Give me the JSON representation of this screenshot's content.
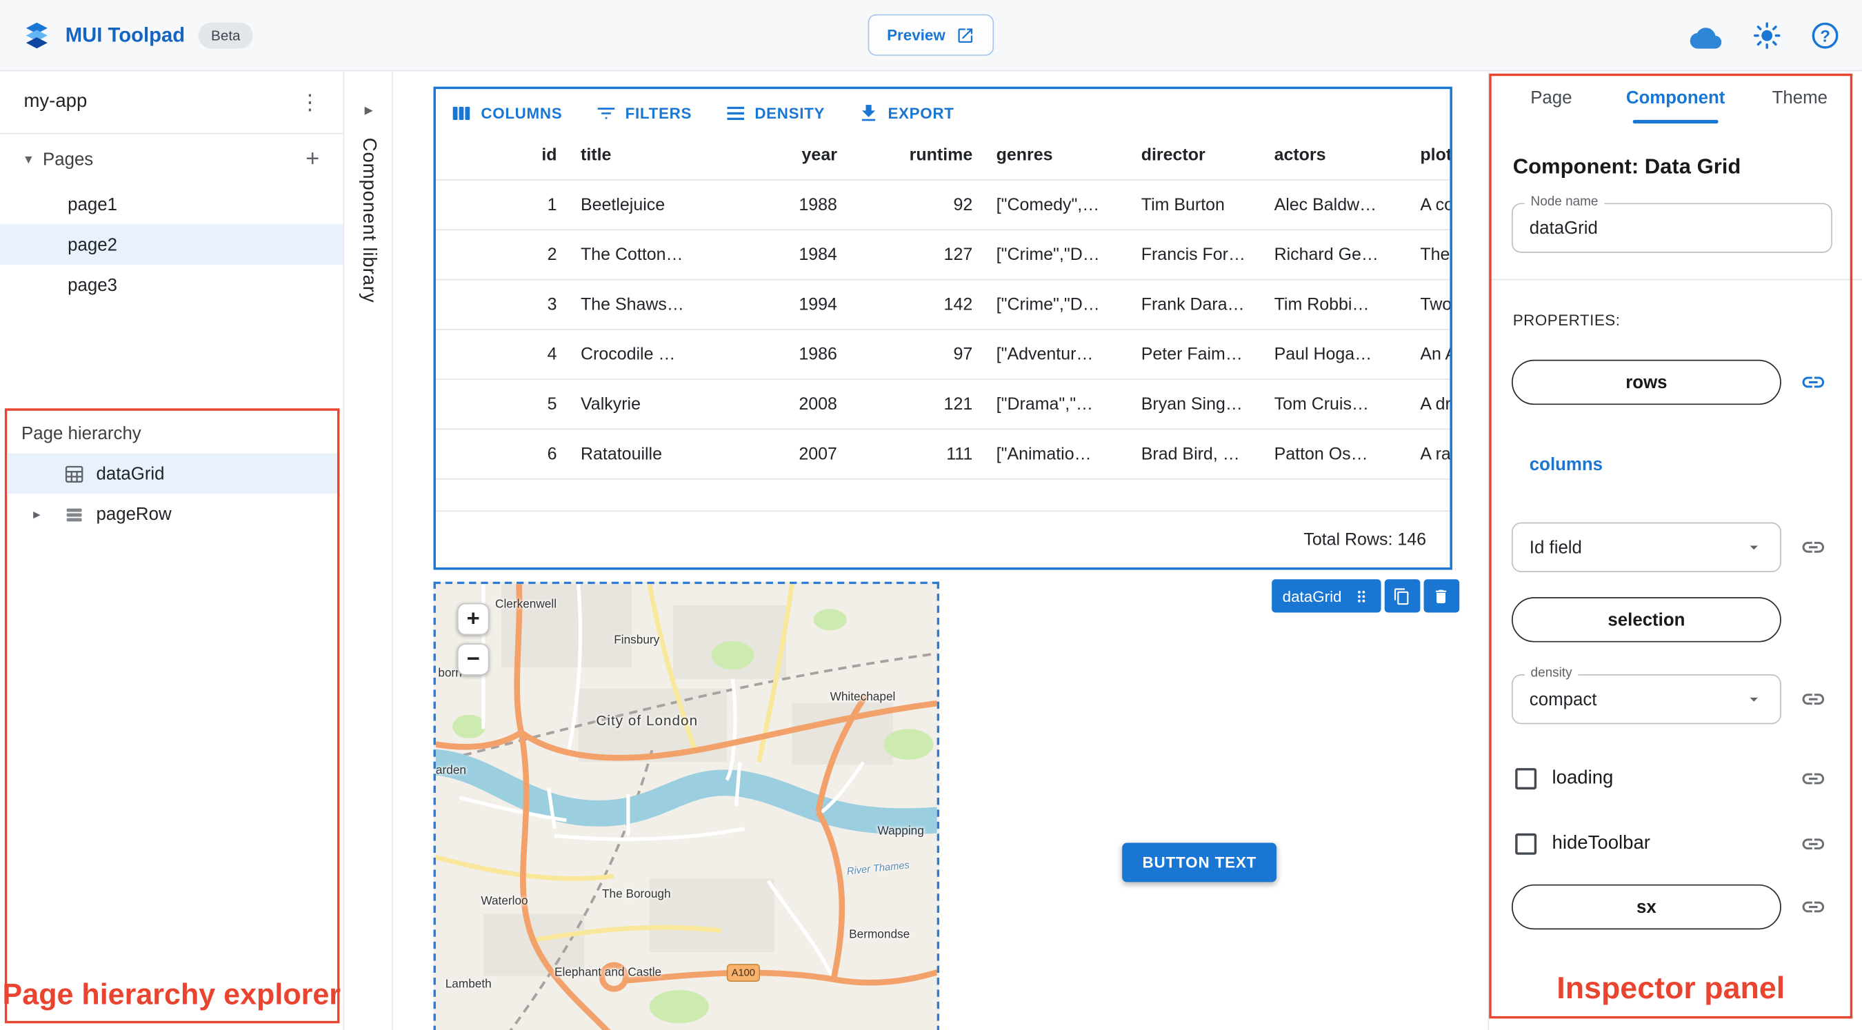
{
  "colors": {
    "accent": "#1976d2",
    "annotation_red": "#e8442f",
    "selected_bg": "#e9f1fd"
  },
  "app_bar": {
    "title": "MUI Toolpad",
    "beta_badge": "Beta",
    "preview_button": "Preview"
  },
  "sidebar": {
    "app_name": "my-app",
    "pages_section": {
      "label": "Pages",
      "items": [
        {
          "label": "page1",
          "selected": false
        },
        {
          "label": "page2",
          "selected": true
        },
        {
          "label": "page3",
          "selected": false
        }
      ]
    },
    "hierarchy": {
      "title": "Page hierarchy",
      "items": [
        {
          "label": "dataGrid",
          "selected": true
        },
        {
          "label": "pageRow",
          "selected": false
        }
      ],
      "annotation": "Page hierarchy explorer"
    }
  },
  "component_library": {
    "label": "Component library"
  },
  "canvas": {
    "datagrid": {
      "toolbar": {
        "columns": "COLUMNS",
        "filters": "FILTERS",
        "density": "DENSITY",
        "export": "EXPORT"
      },
      "columns": [
        "id",
        "title",
        "year",
        "runtime",
        "genres",
        "director",
        "actors",
        "plot"
      ],
      "rows": [
        [
          "1",
          "Beetlejuice",
          "1988",
          "92",
          "[\"Comedy\",…",
          "Tim Burton",
          "Alec Baldw…",
          "A co"
        ],
        [
          "2",
          "The Cotton…",
          "1984",
          "127",
          "[\"Crime\",\"D…",
          "Francis For…",
          "Richard Ge…",
          "The"
        ],
        [
          "3",
          "The Shaws…",
          "1994",
          "142",
          "[\"Crime\",\"D…",
          "Frank Dara…",
          "Tim Robbi…",
          "Two"
        ],
        [
          "4",
          "Crocodile …",
          "1986",
          "97",
          "[\"Adventur…",
          "Peter Faim…",
          "Paul Hoga…",
          "An A"
        ],
        [
          "5",
          "Valkyrie",
          "2008",
          "121",
          "[\"Drama\",\"…",
          "Bryan Sing…",
          "Tom Cruis…",
          "A dr"
        ],
        [
          "6",
          "Ratatouille",
          "2007",
          "111",
          "[\"Animatio…",
          "Brad Bird, …",
          "Patton Os…",
          "A ra"
        ]
      ],
      "footer": "Total Rows: 146",
      "selection_chip": "dataGrid"
    },
    "map": {
      "zoom_in": "+",
      "zoom_out": "−",
      "labels": [
        {
          "text": "Clerkenwell"
        },
        {
          "text": "born"
        },
        {
          "text": "Finsbury"
        },
        {
          "text": "Whitechapel"
        },
        {
          "text": "City of London"
        },
        {
          "text": "arden"
        },
        {
          "text": "Wapping"
        },
        {
          "text": "River Thames"
        },
        {
          "text": "Waterloo"
        },
        {
          "text": "The Borough"
        },
        {
          "text": "Bermondse"
        },
        {
          "text": "Lambeth"
        },
        {
          "text": "Elephant and Castle"
        },
        {
          "text": "A100"
        }
      ]
    },
    "button_label": "BUTTON TEXT"
  },
  "inspector": {
    "tabs": [
      {
        "label": "Page",
        "selected": false
      },
      {
        "label": "Component",
        "selected": true
      },
      {
        "label": "Theme",
        "selected": false
      }
    ],
    "heading": "Component: Data Grid",
    "node_name_field": {
      "label": "Node name",
      "value": "dataGrid"
    },
    "properties_label": "PROPERTIES:",
    "rows_button": "rows",
    "columns_link": "columns",
    "id_field_select": {
      "value": "Id field"
    },
    "selection_button": "selection",
    "density_select": {
      "label": "density",
      "value": "compact"
    },
    "loading_checkbox": {
      "label": "loading",
      "checked": false
    },
    "hide_toolbar_checkbox": {
      "label": "hideToolbar",
      "checked": false
    },
    "sx_button": "sx",
    "annotation": "Inspector panel"
  }
}
